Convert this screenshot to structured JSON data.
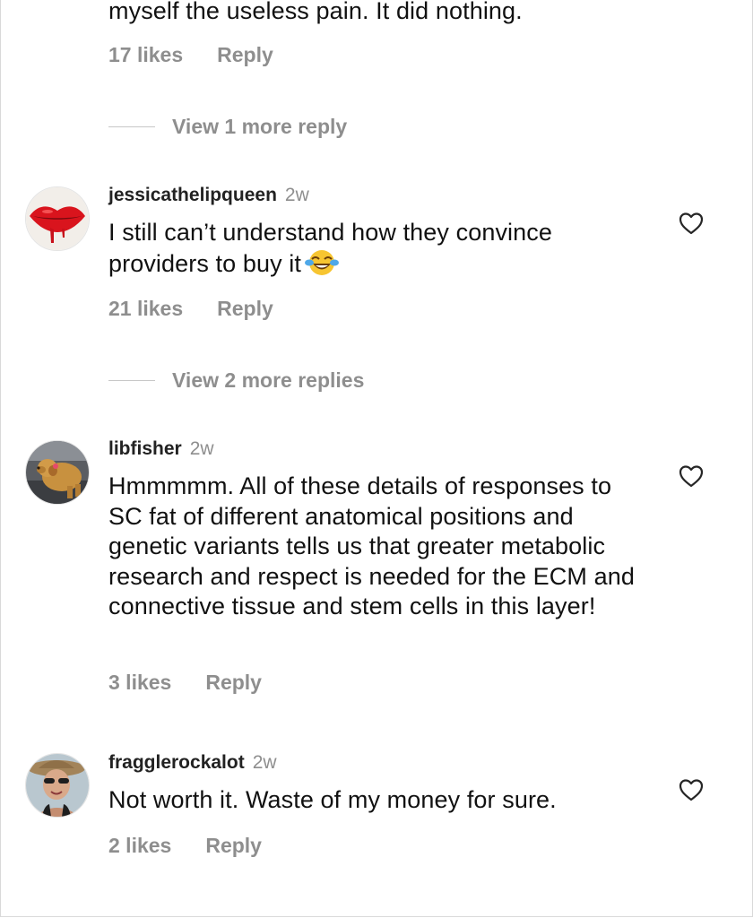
{
  "top_comment": {
    "text_tail": "myself the useless pain. It did nothing.",
    "likes": "17 likes",
    "reply": "Reply",
    "view_more": "View 1 more reply"
  },
  "comments": [
    {
      "username": "jessicathelipqueen",
      "time": "2w",
      "text_line1": "I still can’t understand how they convince",
      "text_line2": "providers to buy it",
      "emoji": "face-with-tears-of-joy",
      "likes": "21 likes",
      "reply": "Reply",
      "view_more": "View 2 more replies",
      "avatar": "red-lips-avatar"
    },
    {
      "username": "libfisher",
      "time": "2w",
      "text": "Hmmmmm.  All of these details of responses to SC fat of different anatomical positions and genetic variants tells us that greater metabolic research and respect is needed for the ECM and connective tissue and stem cells in this layer!",
      "likes": "3 likes",
      "reply": "Reply",
      "avatar": "golden-retriever-avatar"
    },
    {
      "username": "fragglerockalot",
      "time": "2w",
      "text": "Not worth it. Waste of my money for sure.",
      "likes": "2 likes",
      "reply": "Reply",
      "avatar": "woman-with-hat-avatar"
    }
  ],
  "icons": {
    "like": "heart-outline-icon"
  },
  "colors": {
    "text": "#111111",
    "muted": "#8e8e8e",
    "divider": "#c7c7c7"
  }
}
